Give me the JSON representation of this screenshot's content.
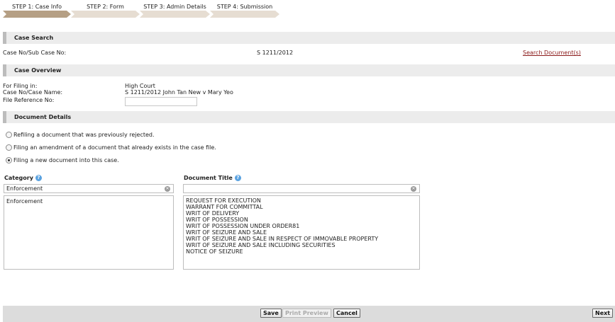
{
  "steps": [
    {
      "label": "STEP 1: Case Info"
    },
    {
      "label": "STEP 2: Form"
    },
    {
      "label": "STEP 3: Admin Details"
    },
    {
      "label": "STEP 4: Submission"
    }
  ],
  "colors": {
    "step_active": "#b59f84",
    "step_inactive": "#e6ddd2"
  },
  "case_search": {
    "title": "Case Search",
    "case_no_label": "Case No/Sub Case No:",
    "case_no_value": "S 1211/2012",
    "search_link": "Search Document(s)"
  },
  "case_overview": {
    "title": "Case Overview",
    "filing_in_label": "For Filing in:",
    "filing_in_value": "High Court",
    "case_name_label": "Case No/Case Name:",
    "case_name_value": "S 1211/2012 John Tan New v Mary Yeo",
    "file_ref_label": "File Reference No:",
    "file_ref_value": ""
  },
  "document_details": {
    "title": "Document Details",
    "options": [
      {
        "label": "Refiling a document that was previously rejected.",
        "selected": false
      },
      {
        "label": "Filing an amendment of a document that already exists in the case file.",
        "selected": false
      },
      {
        "label": "Filing a new document into this case.",
        "selected": true
      }
    ],
    "category": {
      "label": "Category",
      "value": "Enforcement",
      "options": [
        "Enforcement"
      ]
    },
    "document_title": {
      "label": "Document Title",
      "value": "",
      "options": [
        "REQUEST FOR EXECUTION",
        "WARRANT FOR COMMITTAL",
        "WRIT OF DELIVERY",
        "WRIT OF POSSESSION",
        "WRIT OF POSSESSION UNDER ORDER81",
        "WRIT OF SEIZURE AND SALE",
        "WRIT OF SEIZURE AND SALE IN RESPECT OF IMMOVABLE PROPERTY",
        "WRIT OF SEIZURE AND SALE INCLUDING SECURITIES",
        "NOTICE OF SEIZURE"
      ]
    }
  },
  "footer": {
    "save": "Save",
    "print_preview": "Print Preview",
    "cancel": "Cancel",
    "next": "Next"
  }
}
